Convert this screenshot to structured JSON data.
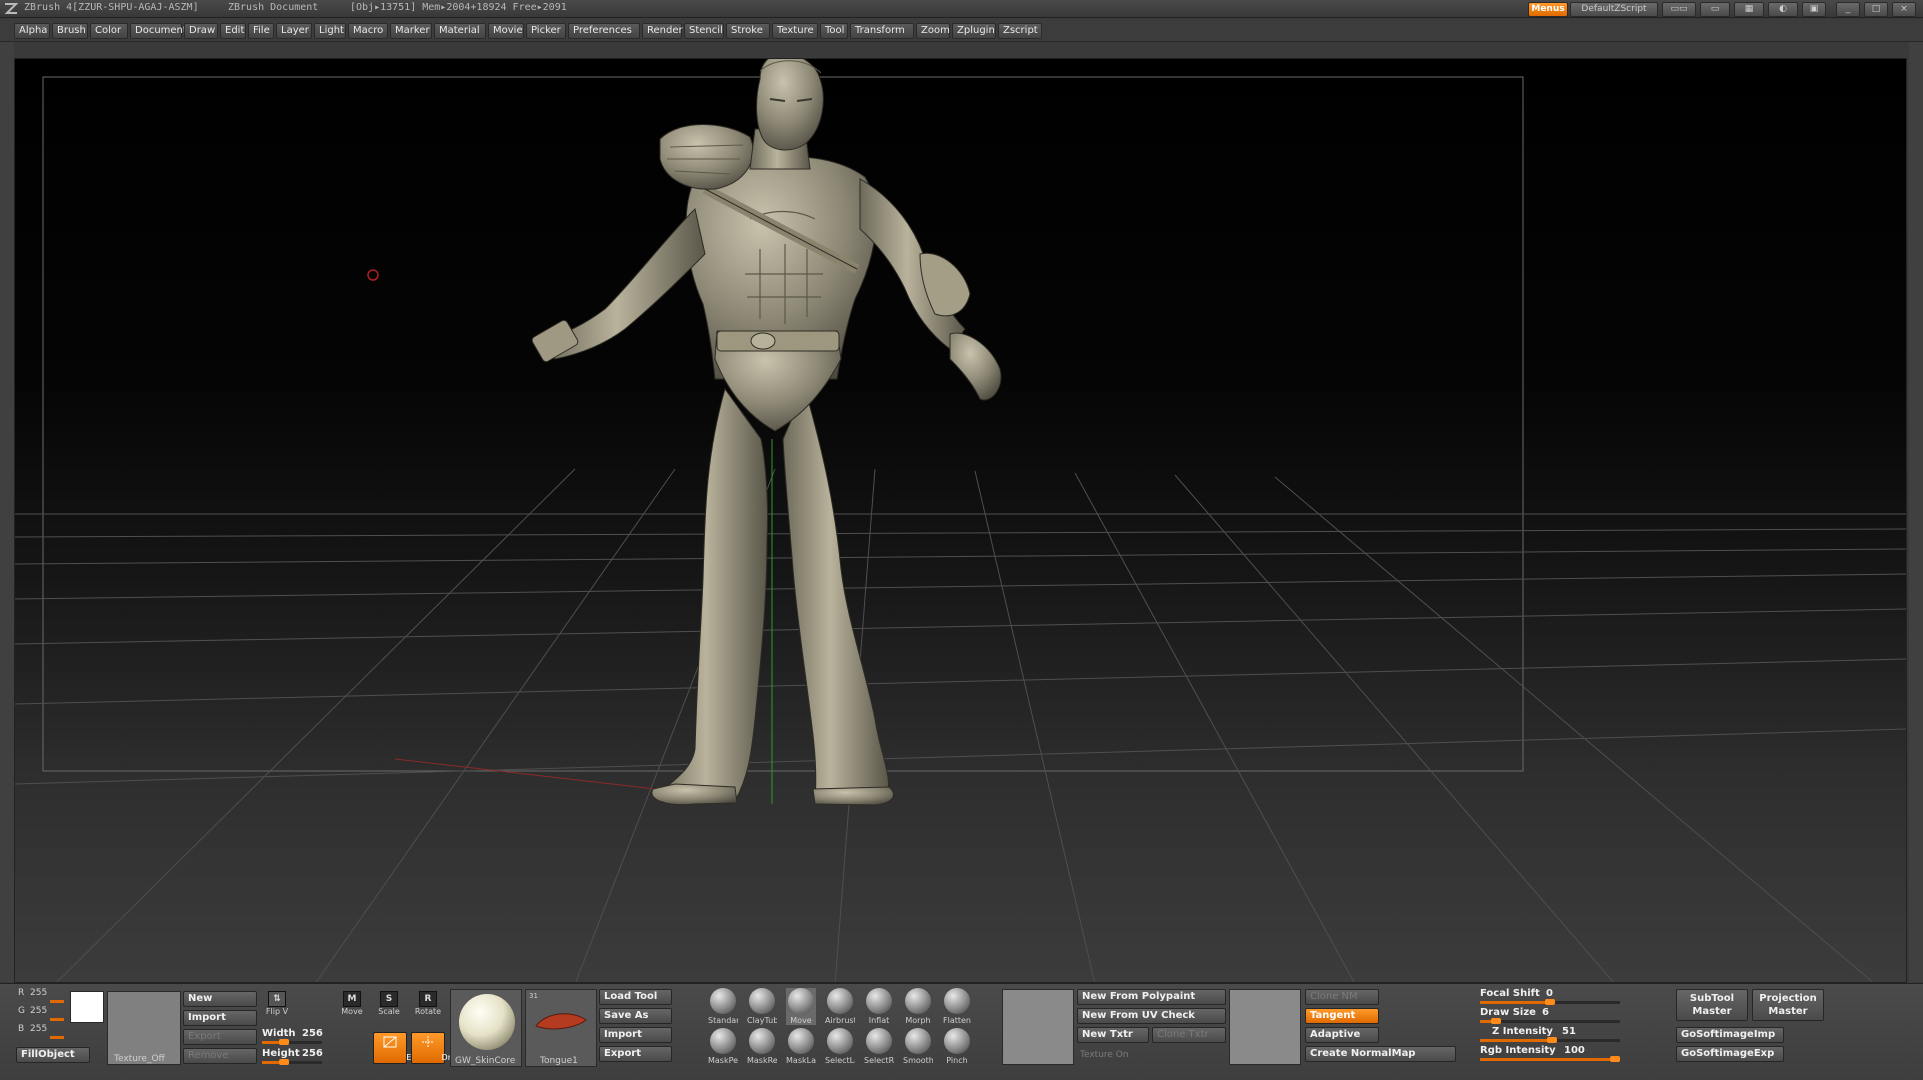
{
  "titlebar": {
    "app": "ZBrush 4[ZZUR-SHPU-AGAJ-ASZM]",
    "doc": "ZBrush Document",
    "stats": "[Obj▸13751] Mem▸2004+18924 Free▸2091",
    "menus": "Menus",
    "script": "DefaultZScript"
  },
  "menus": [
    "Alpha",
    "Brush",
    "Color",
    "Document",
    "Draw",
    "Edit",
    "File",
    "Layer",
    "Light",
    "Macro",
    "Marker",
    "Material",
    "Movie",
    "Picker",
    "Preferences",
    "Render",
    "Stencil",
    "Stroke",
    "Texture",
    "Tool",
    "Transform",
    "Zoom",
    "Zplugin",
    "Zscript"
  ],
  "color": {
    "r_label": "R",
    "r": "255",
    "g_label": "G",
    "g": "255",
    "b_label": "B",
    "b": "255",
    "fill": "FillObject",
    "accent": "#e06a00"
  },
  "texture": {
    "label": "Texture_Off",
    "new": "New",
    "import": "Import",
    "export": "Export",
    "remove": "Remove",
    "flipv": "Flip V",
    "width_label": "Width",
    "width": "256",
    "height_label": "Height",
    "height": "256"
  },
  "transform": {
    "move": "Move",
    "move_key": "M",
    "scale": "Scale",
    "scale_key": "S",
    "rotate": "Rotate",
    "rotate_key": "R",
    "edit": "Edit",
    "draw": "Draw"
  },
  "material": {
    "name": "GW_SkinCore"
  },
  "tool": {
    "name": "Tongue1",
    "count": "31",
    "load": "Load Tool",
    "save": "Save As",
    "import": "Import",
    "export": "Export"
  },
  "brushes": [
    {
      "name": "Standar"
    },
    {
      "name": "ClayTub"
    },
    {
      "name": "Move"
    },
    {
      "name": "Airbrust"
    },
    {
      "name": "Inflat"
    },
    {
      "name": "Morph"
    },
    {
      "name": "Flatten"
    },
    {
      "name": "MaskPer"
    },
    {
      "name": "MaskRe"
    },
    {
      "name": "MaskLa"
    },
    {
      "name": "SelectLa"
    },
    {
      "name": "SelectRe"
    },
    {
      "name": "Smooth"
    },
    {
      "name": "Pinch"
    }
  ],
  "polypaint": {
    "new_from_polypaint": "New From Polypaint",
    "new_from_uv": "New From UV Check",
    "new_txtr": "New Txtr",
    "clone_txtr": "Clone Txtr",
    "texture_on": "Texture On"
  },
  "normalmap": {
    "clone": "Clone NM",
    "tangent": "Tangent",
    "adaptive": "Adaptive",
    "create": "Create NormalMap"
  },
  "draw": {
    "focal_label": "Focal Shift",
    "focal": "0",
    "size_label": "Draw Size",
    "size": "6",
    "z_label": "Z Intensity",
    "z": "51",
    "rgb_label": "Rgb Intensity",
    "rgb": "100"
  },
  "plugins": {
    "subtool": "SubTool Master",
    "projection": "Projection Master",
    "imp": "GoSoftimageImp",
    "exp": "GoSoftimageExp"
  }
}
